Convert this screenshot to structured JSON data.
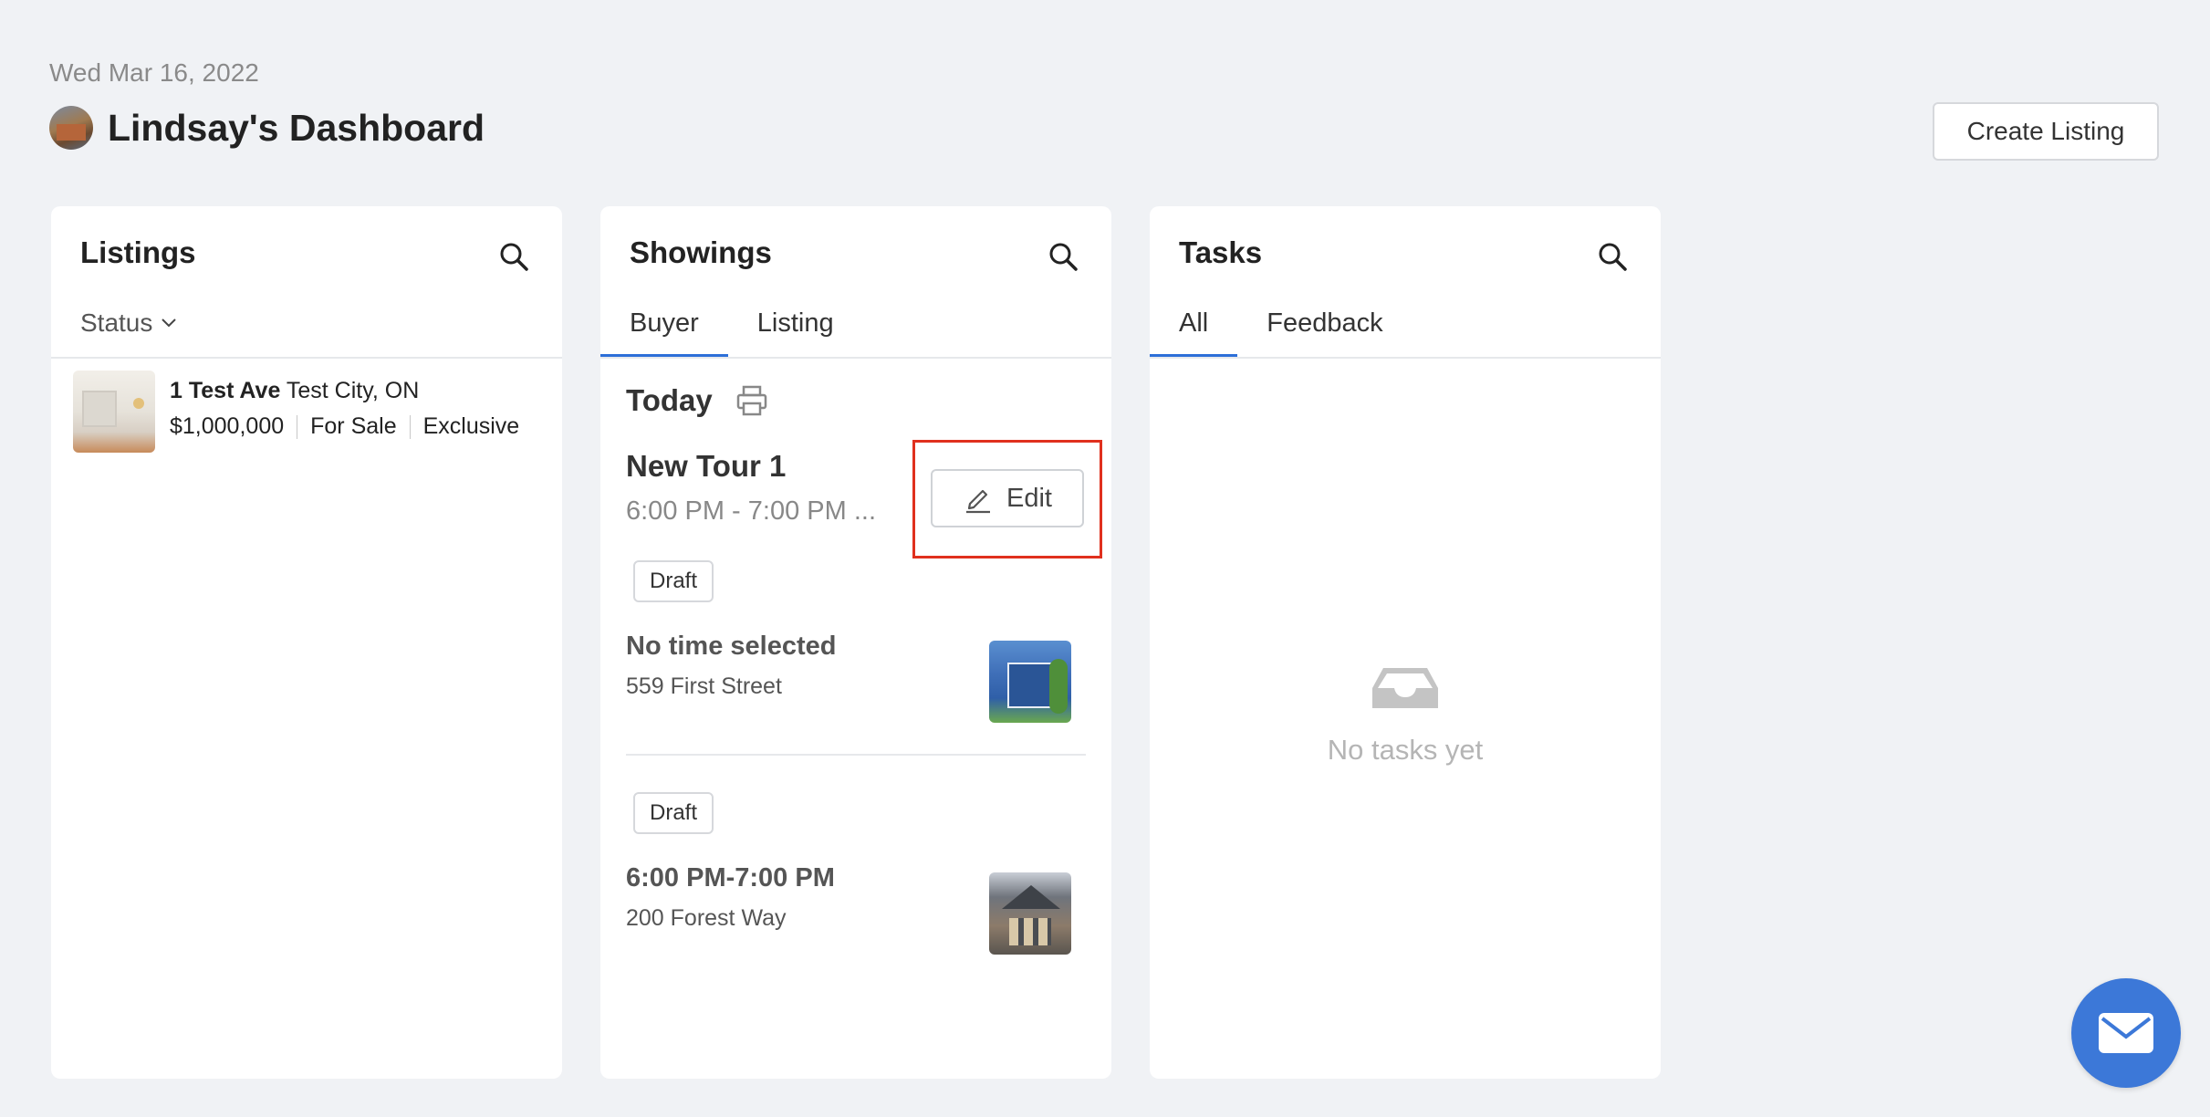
{
  "page": {
    "date": "Wed Mar 16, 2022",
    "title": "Lindsay's Dashboard",
    "create_listing_label": "Create Listing"
  },
  "listings": {
    "title": "Listings",
    "status_filter_label": "Status",
    "items": [
      {
        "street": "1 Test Ave",
        "city": "Test City, ON",
        "price": "$1,000,000",
        "status": "For Sale",
        "type": "Exclusive"
      }
    ]
  },
  "showings": {
    "title": "Showings",
    "tabs": [
      {
        "label": "Buyer",
        "active": true
      },
      {
        "label": "Listing",
        "active": false
      }
    ],
    "today_label": "Today",
    "tour": {
      "title": "New Tour 1",
      "time": "6:00 PM - 7:00 PM ...",
      "edit_label": "Edit"
    },
    "items": [
      {
        "badge": "Draft",
        "time": "No time selected",
        "address": "559 First Street"
      },
      {
        "badge": "Draft",
        "time": "6:00 PM-7:00 PM",
        "address": "200 Forest Way"
      }
    ]
  },
  "tasks": {
    "title": "Tasks",
    "tabs": [
      {
        "label": "All",
        "active": true
      },
      {
        "label": "Feedback",
        "active": false
      }
    ],
    "empty_text": "No tasks yet"
  },
  "colors": {
    "accent": "#2d6fd8",
    "highlight": "#e0301e",
    "fab": "#3c78d8",
    "background": "#f0f2f5"
  },
  "icons": [
    "search-icon",
    "chevron-down-icon",
    "print-icon",
    "pencil-icon",
    "inbox-tray-icon",
    "mail-icon"
  ]
}
